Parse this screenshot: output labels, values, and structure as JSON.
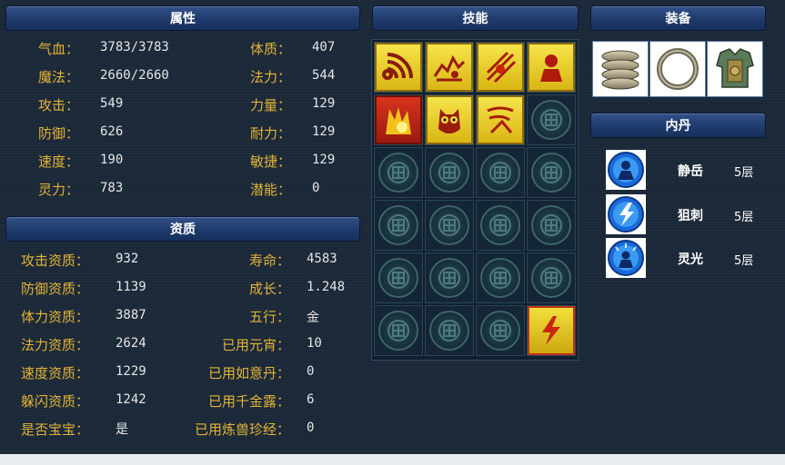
{
  "attributes": {
    "title": "属性",
    "rows": [
      {
        "label": "气血：",
        "value": "3783/3783",
        "label2": "体质：",
        "value2": "407"
      },
      {
        "label": "魔法：",
        "value": "2660/2660",
        "label2": "法力：",
        "value2": "544"
      },
      {
        "label": "攻击：",
        "value": "549",
        "label2": "力量：",
        "value2": "129"
      },
      {
        "label": "防御：",
        "value": "626",
        "label2": "耐力：",
        "value2": "129"
      },
      {
        "label": "速度：",
        "value": "190",
        "label2": "敏捷：",
        "value2": "129"
      },
      {
        "label": "灵力：",
        "value": "783",
        "label2": "潜能：",
        "value2": "0"
      }
    ]
  },
  "aptitude": {
    "title": "资质",
    "rows": [
      {
        "label": "攻击资质：",
        "value": "932",
        "label2": "寿命：",
        "value2": "4583"
      },
      {
        "label": "防御资质：",
        "value": "1139",
        "label2": "成长：",
        "value2": "1.248"
      },
      {
        "label": "体力资质：",
        "value": "3887",
        "label2": "五行：",
        "value2": "金"
      },
      {
        "label": "法力资质：",
        "value": "2624",
        "label2": "已用元宵：",
        "value2": "10"
      },
      {
        "label": "速度资质：",
        "value": "1229",
        "label2": "已用如意丹：",
        "value2": "0"
      },
      {
        "label": "躲闪资质：",
        "value": "1242",
        "label2": "已用千金露：",
        "value2": "6"
      },
      {
        "label": "是否宝宝：",
        "value": "是",
        "label2": "已用炼兽珍经：",
        "value2": "0"
      }
    ]
  },
  "skills": {
    "title": "技能",
    "filled": [
      "signal-skill-icon",
      "cracked-ground-skill-icon",
      "triple-slash-skill-icon",
      "hooded-figure-skill-icon",
      "flame-burst-skill-icon",
      "owl-skill-icon",
      "wind-claw-skill-icon"
    ],
    "active": "lightning-bolt-skill-icon"
  },
  "equipment": {
    "title": "装备",
    "items": [
      "bracer-icon",
      "ring-icon",
      "armor-icon"
    ]
  },
  "inner_pill": {
    "title": "内丹",
    "items": [
      {
        "name": "静岳",
        "level": "5层",
        "icon": "static-mountain-icon"
      },
      {
        "name": "狙刺",
        "level": "5层",
        "icon": "lightning-thorn-icon"
      },
      {
        "name": "灵光",
        "level": "5层",
        "icon": "spirit-light-icon"
      }
    ]
  },
  "colors": {
    "label": "#e2b436",
    "value": "#e6e6e6",
    "header": "#1f3a6b",
    "background": "#1b2838"
  }
}
